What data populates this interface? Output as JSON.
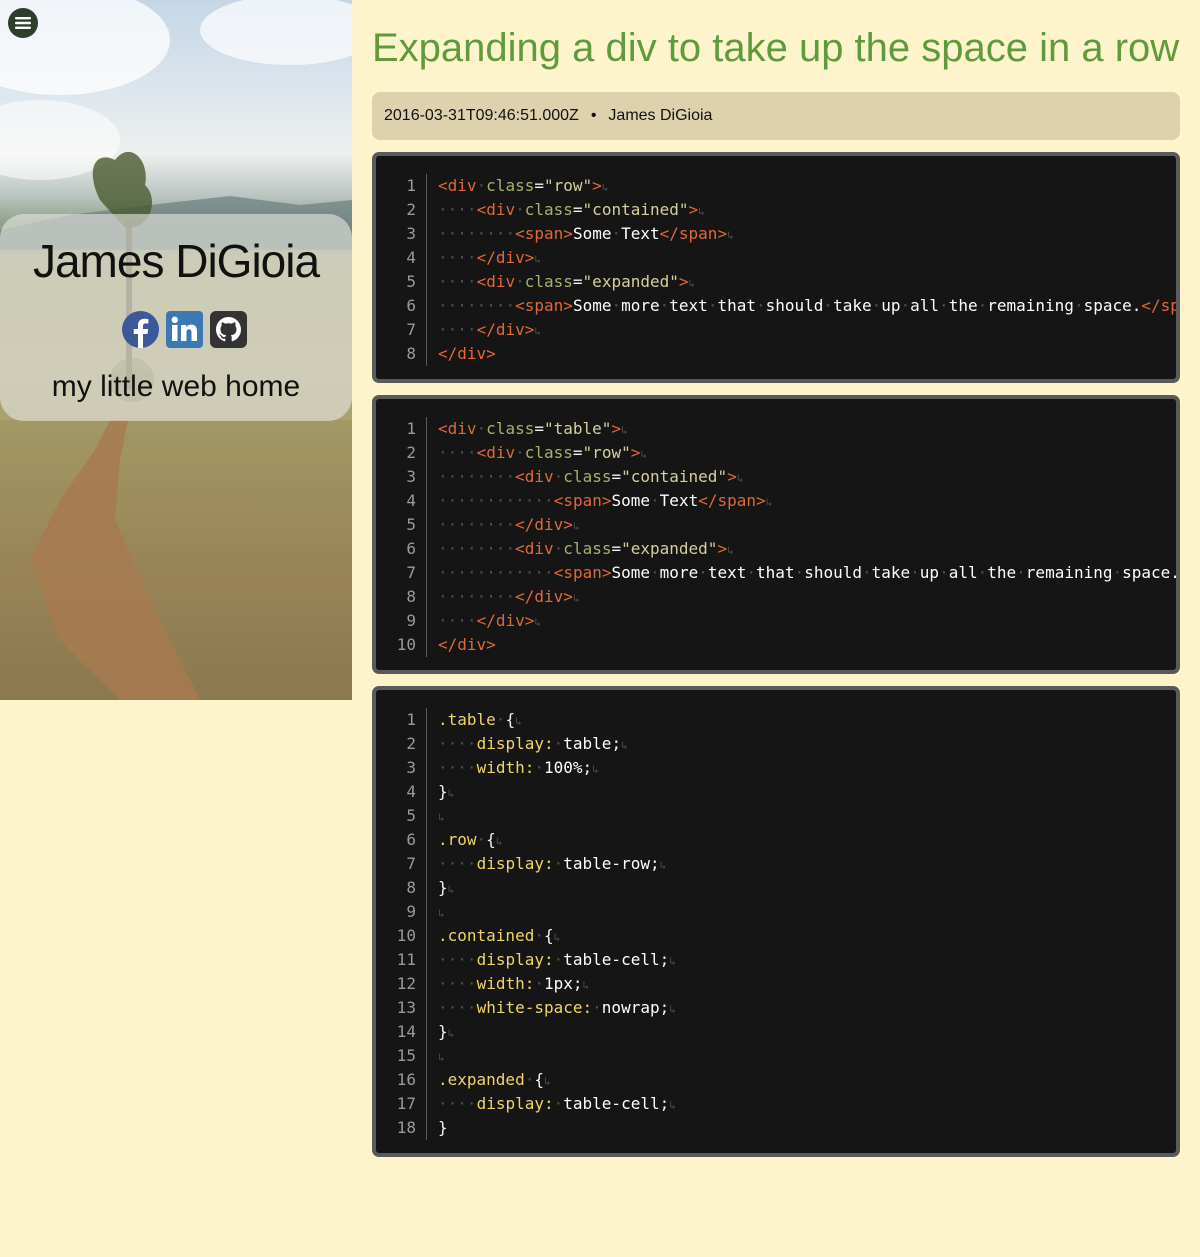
{
  "sidebar": {
    "name": "James DiGioia",
    "tagline": "my little web home",
    "social": [
      {
        "icon": "facebook-icon",
        "color": "#3b5998"
      },
      {
        "icon": "linkedin-icon",
        "color": "#3c78b3"
      },
      {
        "icon": "github-icon",
        "color": "#333333"
      }
    ]
  },
  "post": {
    "title": "Expanding a div to take up the space in a row",
    "timestamp": "2016-03-31T09:46:51.000Z",
    "separator": "•",
    "author": "James DiGioia"
  },
  "code_blocks": [
    {
      "language": "html",
      "lines": [
        "<div class=\"row\">",
        "    <div class=\"contained\">",
        "        <span>Some Text</span>",
        "    </div>",
        "    <div class=\"expanded\">",
        "        <span>Some more text that should take up all the remaining space.</span>",
        "    </div>",
        "</div>"
      ]
    },
    {
      "language": "html",
      "lines": [
        "<div class=\"table\">",
        "    <div class=\"row\">",
        "        <div class=\"contained\">",
        "            <span>Some Text</span>",
        "        </div>",
        "        <div class=\"expanded\">",
        "            <span>Some more text that should take up all the remaining space.</span>",
        "        </div>",
        "    </div>",
        "</div>"
      ]
    },
    {
      "language": "css",
      "lines": [
        ".table {",
        "    display: table;",
        "    width: 100%;",
        "}",
        "",
        ".row {",
        "    display: table-row;",
        "}",
        "",
        ".contained {",
        "    display: table-cell;",
        "    width: 1px;",
        "    white-space: nowrap;",
        "}",
        "",
        ".expanded {",
        "    display: table-cell;",
        "}"
      ]
    }
  ]
}
